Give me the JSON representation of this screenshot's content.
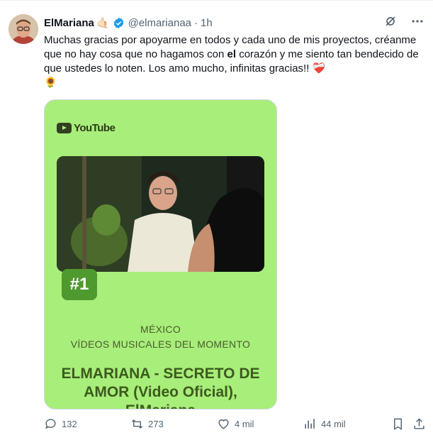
{
  "tweet": {
    "display_name": "ElMariana",
    "handle": "@elmarianaa",
    "separator": "·",
    "time": "1h",
    "text_before_bold": "Muchas gracias por apoyarme en todos y cada uno de mis proyectos, créanme que no hay cosa que no hagamos con ",
    "text_bold": "el",
    "text_after_bold": " corazón y me siento tan bendecido de que ustedes lo noten. Los amo mucho, infinitas gracias!! ❤️‍🩹",
    "sunflower": "🌻"
  },
  "card": {
    "brand": "YouTube",
    "rank": "#1",
    "country": "MÉXICO",
    "category": "VÍDEOS MUSICALES DEL MOMENTO",
    "song_title": "ELMARIANA - SECRETO DE AMOR (Video Oficial), ElMariana",
    "background_color": "#a8ee7a"
  },
  "actions": {
    "replies": "132",
    "reposts": "273",
    "likes": "4 mil",
    "views": "44 mil"
  },
  "icons": [
    "verified-badge-icon",
    "grok-icon",
    "more-icon",
    "reply-icon",
    "repost-icon",
    "like-icon",
    "views-icon",
    "bookmark-icon",
    "share-icon"
  ]
}
